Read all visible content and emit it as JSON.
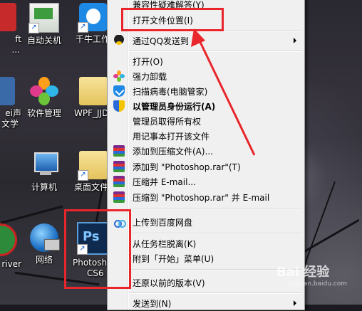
{
  "desktop": {
    "icons": [
      {
        "label": "ft",
        "sub": "..."
      },
      {
        "label": "自动关机"
      },
      {
        "label": "千牛工作"
      },
      {
        "label": "软件管理"
      },
      {
        "label": "WPF_JJD"
      },
      {
        "label": "ei声",
        "sub": "文学"
      },
      {
        "label": "计算机"
      },
      {
        "label": "桌面文件"
      },
      {
        "label": "river"
      },
      {
        "label": "网络"
      },
      {
        "label": "Photoshop",
        "sub": "CS6"
      }
    ]
  },
  "context_menu": {
    "items": [
      {
        "label": "兼容性疑难解答(Y)"
      },
      {
        "label": "打开文件位置(I)"
      },
      {
        "label": "通过QQ发送到"
      },
      {
        "label": "打开(O)"
      },
      {
        "label": "强力卸载"
      },
      {
        "label": "扫描病毒(电脑管家)"
      },
      {
        "label": "以管理员身份运行(A)"
      },
      {
        "label": "管理员取得所有权"
      },
      {
        "label": "用记事本打开该文件"
      },
      {
        "label": "添加到压缩文件(A)..."
      },
      {
        "label": "添加到 \"Photoshop.rar\"(T)"
      },
      {
        "label": "压缩并 E-mail..."
      },
      {
        "label": "压缩到 \"Photoshop.rar\" 并 E-mail"
      },
      {
        "label": "上传到百度网盘"
      },
      {
        "label": "从任务栏脱离(K)"
      },
      {
        "label": "附到「开始」菜单(U)"
      },
      {
        "label": "还原以前的版本(V)"
      },
      {
        "label": "发送到(N)"
      }
    ]
  },
  "watermark": {
    "text": "Bai 经验",
    "sub": "jingyan.baidu.com"
  },
  "colors": {
    "annotation": "#e8262b",
    "menu_bg": "#f0f0f0"
  }
}
